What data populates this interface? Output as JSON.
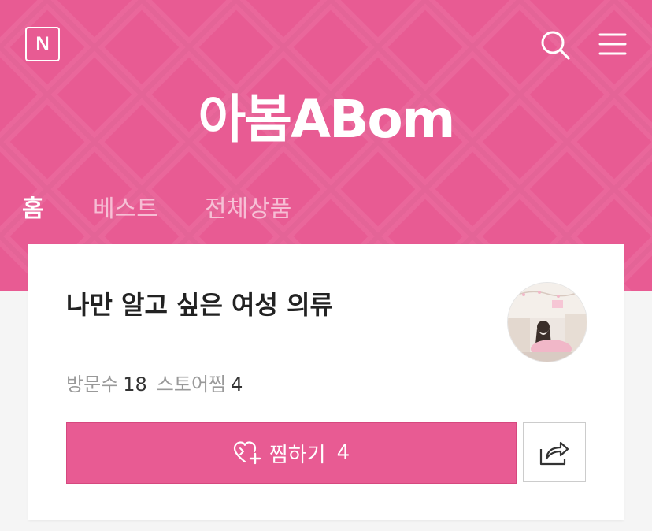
{
  "colors": {
    "brand": "#e85b93",
    "text_dark": "#222222",
    "text_muted": "#999999"
  },
  "header": {
    "logo_letter": "N",
    "icons": {
      "search": "search-icon",
      "menu": "hamburger-menu-icon"
    },
    "store_name": "아봄ABom"
  },
  "tabs": [
    {
      "label": "홈",
      "active": true
    },
    {
      "label": "베스트",
      "active": false
    },
    {
      "label": "전체상품",
      "active": false
    }
  ],
  "profile": {
    "description": "나만 알고 싶은 여성 의류",
    "stats": {
      "visitors_label": "방문수",
      "visitors_value": "18",
      "favorites_label": "스토어찜",
      "favorites_value": "4"
    },
    "favorite_button": {
      "label": "찜하기",
      "count": "4",
      "icon": "heart-plus-icon"
    },
    "share_button": {
      "icon": "share-icon"
    }
  }
}
